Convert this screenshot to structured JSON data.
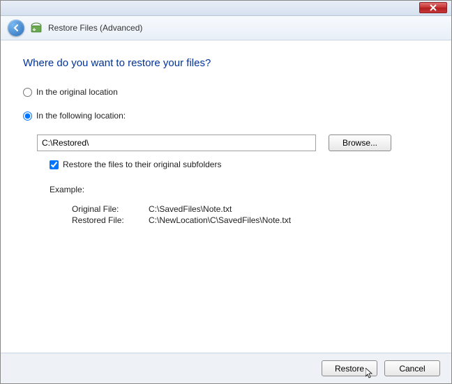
{
  "header": {
    "title": "Restore Files (Advanced)"
  },
  "page": {
    "heading": "Where do you want to restore your files?"
  },
  "options": {
    "original_label": "In the original location",
    "following_label": "In the following location:",
    "selected": "following",
    "path_value": "C:\\Restored\\",
    "browse_label": "Browse...",
    "subfolders_label": "Restore the files to their original subfolders",
    "subfolders_checked": true
  },
  "example": {
    "title": "Example:",
    "original_label": "Original File:",
    "original_value": "C:\\SavedFiles\\Note.txt",
    "restored_label": "Restored File:",
    "restored_value": "C:\\NewLocation\\C\\SavedFiles\\Note.txt"
  },
  "buttons": {
    "restore": "Restore",
    "cancel": "Cancel"
  }
}
